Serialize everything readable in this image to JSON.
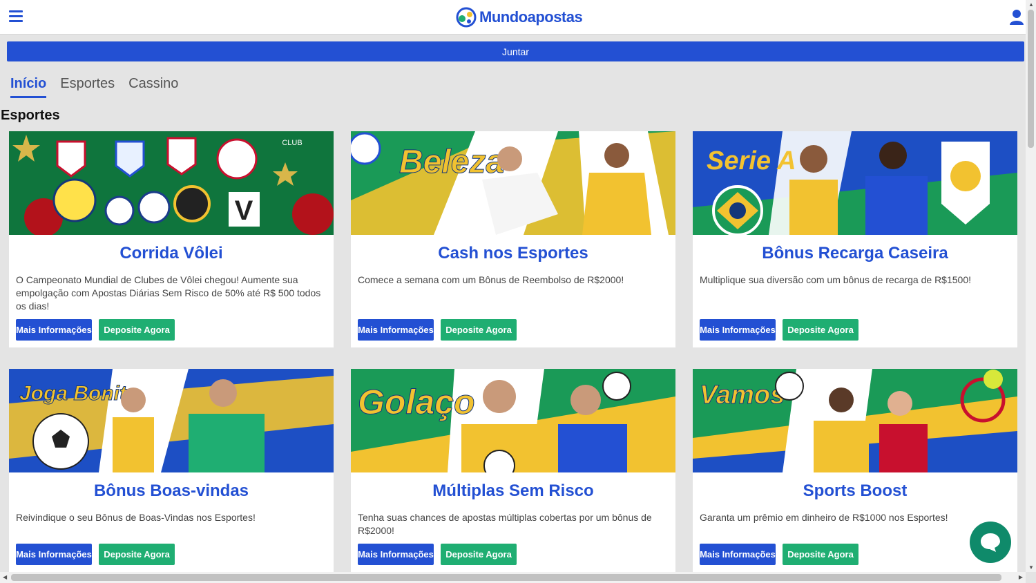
{
  "header": {
    "logo_text": "Mundoapostas",
    "join_label": "Juntar"
  },
  "tabs": [
    {
      "label": "Início",
      "active": true
    },
    {
      "label": "Esportes",
      "active": false
    },
    {
      "label": "Cassino",
      "active": false
    }
  ],
  "section": {
    "title": "Esportes"
  },
  "buttons": {
    "info_label": "Mais Informações",
    "deposit_label": "Deposite Agora"
  },
  "cards": [
    {
      "title": "Corrida Vôlei",
      "description": "O Campeonato Mundial de Clubes de Vôlei chegou! Aumente sua empolgação com Apostas Diárias Sem Risco de 50% até R$ 500 todos os dias!",
      "banner_text": "",
      "theme": "green"
    },
    {
      "title": "Cash nos Esportes",
      "description": "Comece a semana com um Bônus de Reembolso de R$2000!",
      "banner_text": "Beleza",
      "theme": "green-yellow"
    },
    {
      "title": "Bônus Recarga Caseira",
      "description": "Multiplique sua diversão com um bônus de recarga de R$1500!",
      "banner_text": "Serie A",
      "theme": "blue"
    },
    {
      "title": "Bônus Boas-vindas",
      "description": "Reivindique o seu Bônus de Boas-Vindas nos Esportes!",
      "banner_text": "Joga Bonito",
      "theme": "blue-green"
    },
    {
      "title": "Múltiplas Sem Risco",
      "description": "Tenha suas chances de apostas múltiplas cobertas por um bônus de R$2000!",
      "banner_text": "Golaço",
      "theme": "green-yellow"
    },
    {
      "title": "Sports Boost",
      "description": "Garanta um prêmio em dinheiro de R$1000 nos Esportes!",
      "banner_text": "Vamos",
      "theme": "green"
    }
  ],
  "colors": {
    "brand_blue": "#2350d3",
    "deposit_green": "#1fae72",
    "chat_green": "#0f8a6a"
  },
  "icons": {
    "menu": "hamburger-icon",
    "user": "user-icon",
    "chat": "chat-bubble-icon"
  }
}
